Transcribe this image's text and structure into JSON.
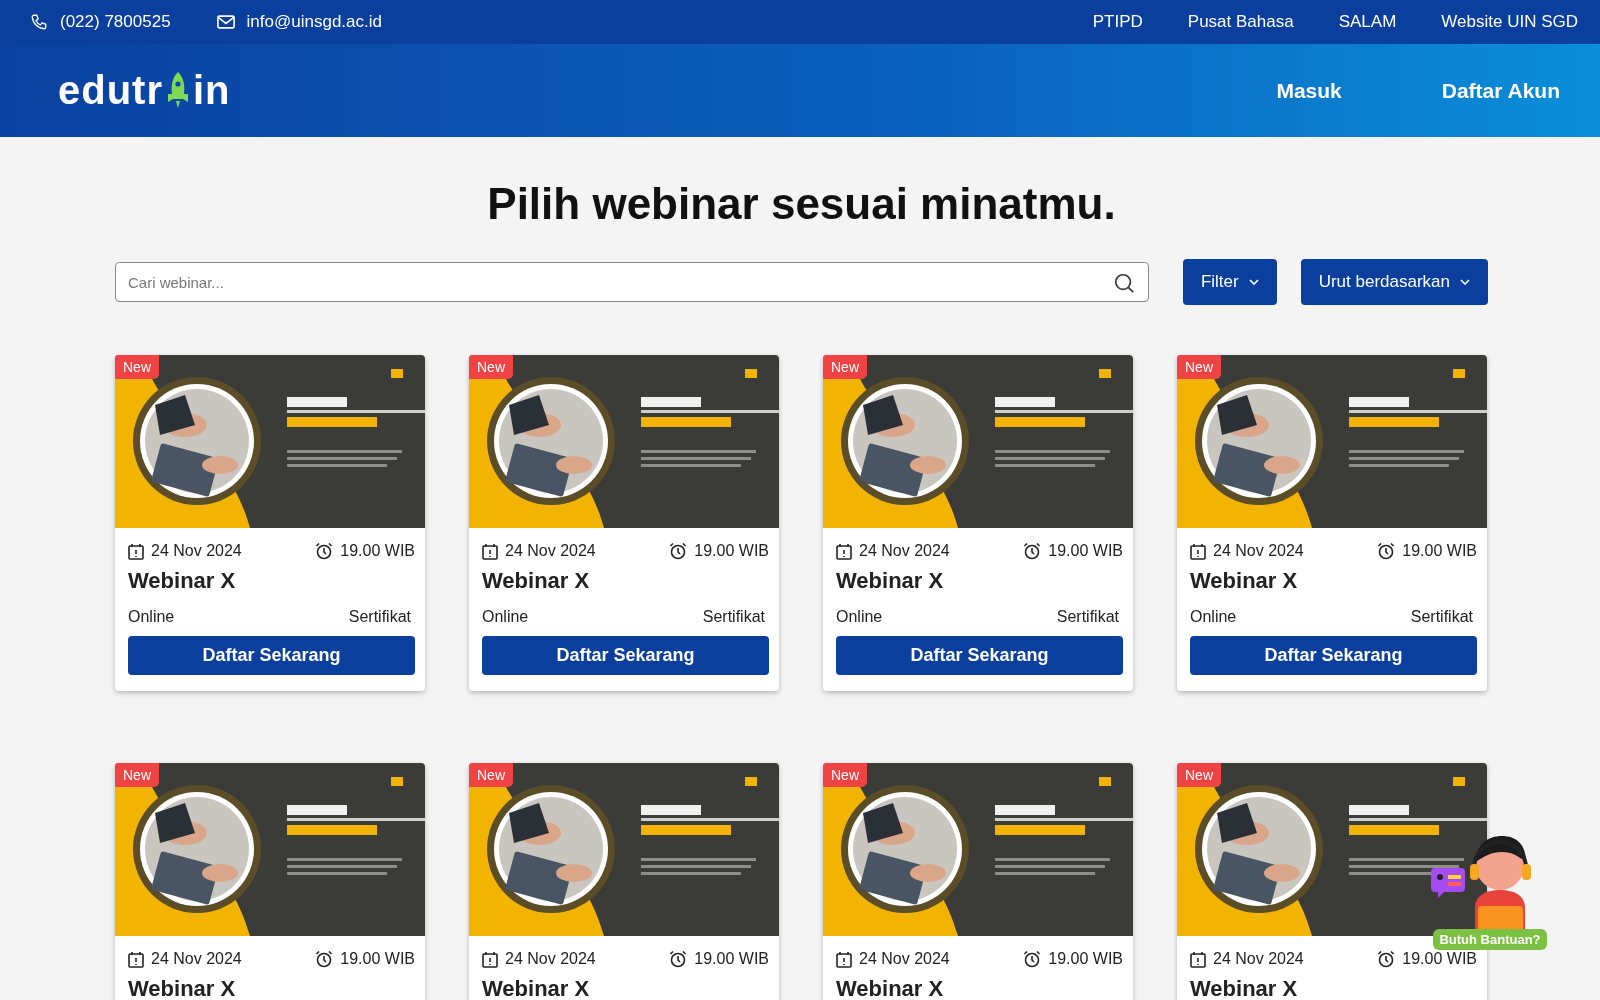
{
  "top_bar": {
    "phone": "(022) 7800525",
    "email": "info@uinsgd.ac.id",
    "links": [
      "PTIPD",
      "Pusat Bahasa",
      "SALAM",
      "Website UIN SGD"
    ]
  },
  "header": {
    "logo": {
      "before": "edutr",
      "after": "in"
    },
    "nav": [
      "Masuk",
      "Daftar Akun"
    ]
  },
  "heading": "Pilih webinar sesuai minatmu.",
  "search": {
    "placeholder": "Cari webinar..."
  },
  "filter_button": "Filter",
  "sort_button": "Urut berdasarkan",
  "cards": [
    {
      "badge": "New",
      "date": "24 Nov 2024",
      "time": "19.00 WIB",
      "title": "Webinar X",
      "mode": "Online",
      "certificate": "Sertifikat",
      "button": "Daftar Sekarang"
    },
    {
      "badge": "New",
      "date": "24 Nov 2024",
      "time": "19.00 WIB",
      "title": "Webinar X",
      "mode": "Online",
      "certificate": "Sertifikat",
      "button": "Daftar Sekarang"
    },
    {
      "badge": "New",
      "date": "24 Nov 2024",
      "time": "19.00 WIB",
      "title": "Webinar X",
      "mode": "Online",
      "certificate": "Sertifikat",
      "button": "Daftar Sekarang"
    },
    {
      "badge": "New",
      "date": "24 Nov 2024",
      "time": "19.00 WIB",
      "title": "Webinar X",
      "mode": "Online",
      "certificate": "Sertifikat",
      "button": "Daftar Sekarang"
    },
    {
      "badge": "New",
      "date": "24 Nov 2024",
      "time": "19.00 WIB",
      "title": "Webinar X"
    },
    {
      "badge": "New",
      "date": "24 Nov 2024",
      "time": "19.00 WIB",
      "title": "Webinar X"
    },
    {
      "badge": "New",
      "date": "24 Nov 2024",
      "time": "19.00 WIB",
      "title": "Webinar X"
    },
    {
      "badge": "New",
      "date": "24 Nov 2024",
      "time": "19.00 WIB",
      "title": "Webinar X"
    }
  ],
  "help": {
    "label": "Butuh Bantuan?"
  }
}
